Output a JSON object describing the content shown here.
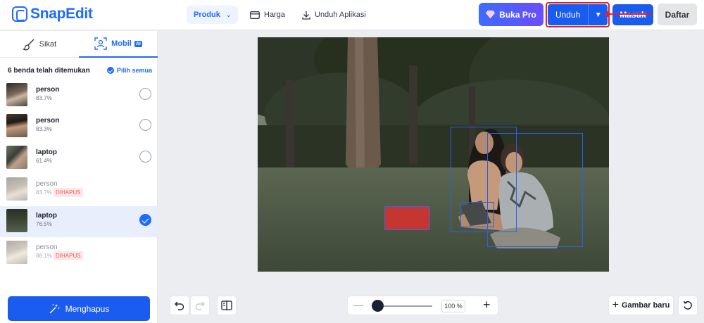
{
  "header": {
    "logo_text": "SnapEdit",
    "nav": {
      "produk": "Produk",
      "harga": "Harga",
      "unduh_aplikasi": "Unduh Aplikasi"
    },
    "buka_pro": "Buka Pro",
    "unduh": "Unduh",
    "masuk": "Masuk",
    "daftar": "Daftar"
  },
  "sidebar": {
    "tabs": {
      "sikat": "Sikat",
      "mobil": "Mobil",
      "mobil_badge": "AI"
    },
    "found_label": "6 benda telah ditemukan",
    "select_all": "Pilih semua",
    "objects": [
      {
        "name": "person",
        "score": "83.7%",
        "deleted": false,
        "selected": false
      },
      {
        "name": "person",
        "score": "83.3%",
        "deleted": false,
        "selected": false
      },
      {
        "name": "laptop",
        "score": "61.4%",
        "deleted": false,
        "selected": false
      },
      {
        "name": "person",
        "score": "83.7%",
        "deleted": true,
        "status": "DIHAPUS",
        "selected": false
      },
      {
        "name": "laptop",
        "score": "76.5%",
        "deleted": false,
        "selected": true
      },
      {
        "name": "person",
        "score": "88.1%",
        "deleted": true,
        "status": "DIHAPUS",
        "selected": false
      }
    ],
    "remove_button": "Menghapus"
  },
  "toolbar": {
    "zoom_value": "100 %",
    "zoom_fraction": 0.0,
    "new_image": "Gambar baru"
  },
  "colors": {
    "brand_blue": "#1b5cf0",
    "accent_red": "#e0222a",
    "mask_red": "#c4362f",
    "selected_row": "#e9eefc"
  },
  "icons": [
    "logo-icon",
    "credit-card-icon",
    "download-icon",
    "gem-icon",
    "brush-icon",
    "object-select-icon",
    "check-circle-icon",
    "magic-wand-icon",
    "undo-icon",
    "redo-icon",
    "compare-icon",
    "reset-icon"
  ]
}
